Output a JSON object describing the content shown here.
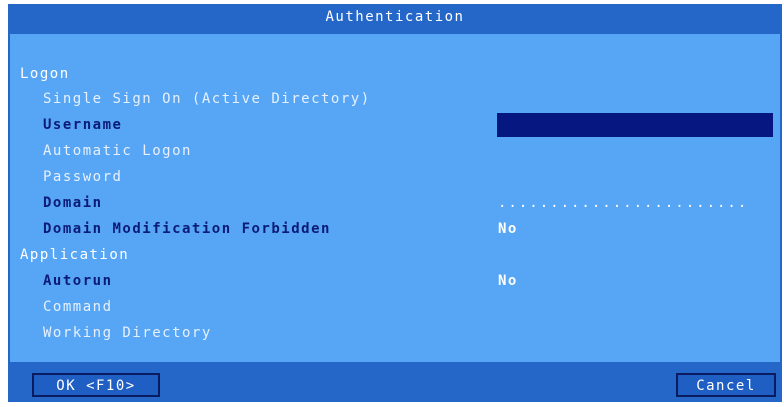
{
  "dialog": {
    "title": "Authentication"
  },
  "logon": {
    "section_label": "Logon",
    "sso_label": "Single Sign On (Active Directory)",
    "username_label": "Username",
    "username_value": "",
    "automatic_logon_label": "Automatic Logon",
    "password_label": "Password",
    "domain_label": "Domain",
    "domain_value": "........................",
    "domain_mod_label": "Domain Modification Forbidden",
    "domain_mod_value": "No"
  },
  "application": {
    "section_label": "Application",
    "autorun_label": "Autorun",
    "autorun_value": "No",
    "command_label": "Command",
    "working_dir_label": "Working Directory"
  },
  "buttons": {
    "ok_label": "OK <F10>",
    "cancel_label": "Cancel"
  },
  "colors": {
    "frame": "#2467c9",
    "panel": "#57a6f5",
    "input_fill": "#071782",
    "label_active": "#0b1b78",
    "label_dim": "#e6f0ff"
  }
}
